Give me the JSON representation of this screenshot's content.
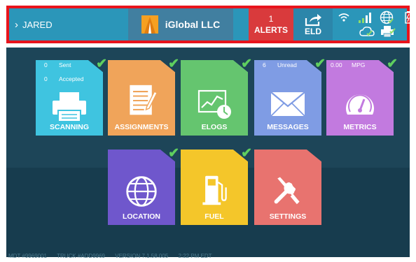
{
  "topbar": {
    "user_name": "JARED",
    "company_name": "iGlobal LLC",
    "alerts_count": "1",
    "alerts_label": "ALERTS",
    "eld_label": "ELD",
    "status_icons": [
      "wifi-icon",
      "signal-bars-icon",
      "globe-icon",
      "battery-icon",
      "cloud-check-icon",
      "printer-check-icon"
    ]
  },
  "tiles": {
    "scanning": {
      "label": "SCANNING",
      "sent_count": "0",
      "sent_label": "Sent",
      "accepted_count": "0",
      "accepted_label": "Accepted",
      "color": "#3fc4e0",
      "checked": true
    },
    "assignments": {
      "label": "ASSIGNMENTS",
      "color": "#f0a45a",
      "checked": true
    },
    "elogs": {
      "label": "ELOGS",
      "color": "#65c56f",
      "checked": true
    },
    "messages": {
      "label": "MESSAGES",
      "unread_count": "6",
      "unread_label": "Unread",
      "color": "#7f9ce4",
      "checked": true
    },
    "metrics": {
      "label": "METRICS",
      "mpg_value": "0.00",
      "mpg_label": "MPG",
      "color": "#c27adf",
      "checked": true
    },
    "location": {
      "label": "LOCATION",
      "color": "#6f57cc",
      "checked": true
    },
    "fuel": {
      "label": "FUEL",
      "color": "#f4c62a",
      "checked": true
    },
    "settings": {
      "label": "SETTINGS",
      "color": "#e8736f",
      "checked": false
    }
  },
  "footer": {
    "mdt": "MDT #9969001",
    "truck": "TRUCK #ADD9969",
    "version": "VERSION 7.1.58.005",
    "time": "2:22 PM EDT"
  },
  "check_glyph": "✔"
}
